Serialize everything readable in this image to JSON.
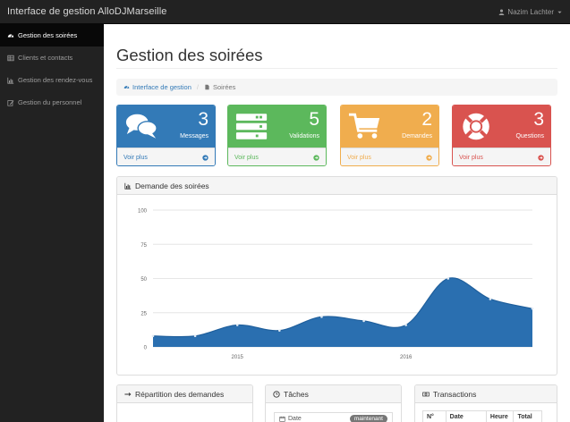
{
  "navbar": {
    "brand": "Interface de gestion AlloDJMarseille",
    "user": "Nazim Lachter"
  },
  "sidebar": {
    "items": [
      {
        "label": "Gestion des soirées",
        "icon": "dashboard-icon",
        "active": true
      },
      {
        "label": "Clients et contacts",
        "icon": "table-icon",
        "active": false
      },
      {
        "label": "Gestion des rendez-vous",
        "icon": "bar-chart-icon",
        "active": false
      },
      {
        "label": "Gestion du personnel",
        "icon": "edit-icon",
        "active": false
      }
    ]
  },
  "page": {
    "title": "Gestion des soirées"
  },
  "breadcrumb": {
    "home": "Interface de gestion",
    "current": "Soirées"
  },
  "stats": [
    {
      "value": "3",
      "label": "Messages",
      "link": "Voir plus",
      "color": "#337ab7",
      "icon": "comments-icon"
    },
    {
      "value": "5",
      "label": "Validations",
      "link": "Voir plus",
      "color": "#5cb85c",
      "icon": "tasks-icon"
    },
    {
      "value": "2",
      "label": "Demandes",
      "link": "Voir plus",
      "color": "#f0ad4e",
      "icon": "shopping-cart-icon"
    },
    {
      "value": "3",
      "label": "Questions",
      "link": "Voir plus",
      "color": "#d9534f",
      "icon": "support-icon"
    }
  ],
  "chart_panel": {
    "title": "Demande des soirées"
  },
  "chart_data": {
    "type": "area",
    "title": "Demande des soirées",
    "xlabel": "",
    "ylabel": "",
    "x": [
      "2014-07",
      "2014-10",
      "2015-01",
      "2015-04",
      "2015-07",
      "2015-10",
      "2016-01",
      "2016-04",
      "2016-07",
      "2016-10"
    ],
    "values": [
      8,
      8,
      16,
      12,
      22,
      19,
      16,
      50,
      35,
      28
    ],
    "x_ticks": [
      "2015",
      "2016"
    ],
    "y_ticks": [
      0,
      25,
      50,
      75,
      100
    ],
    "ylim": [
      0,
      100
    ],
    "grid": true,
    "color": "#2a6fb0"
  },
  "bottom_panels": {
    "repartition": "Répartition des demandes",
    "taches": "Tâches",
    "task_date_label": "Date",
    "task_badge": "maintenant",
    "transactions": "Transactions",
    "tx_columns": [
      "N°",
      "Date",
      "Heure",
      "Total"
    ]
  }
}
